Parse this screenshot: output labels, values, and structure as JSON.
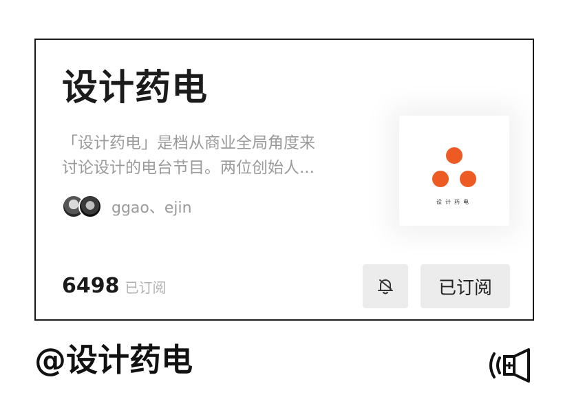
{
  "card": {
    "title": "设计药电",
    "description_line1": "「设计药电」是档从商业全局角度来",
    "description_line2": "讨论设计的电台节目。两位创始人...",
    "hosts": "ggao、ejin",
    "cover_text": "设计药电",
    "subscriber_count": "6498",
    "subscriber_label": "已订阅",
    "subscribe_button": "已订阅",
    "accent_color": "#ee5a24"
  },
  "footer": {
    "channel_name": "@设计药电",
    "sound_icon": "speaker-sound-icon"
  },
  "icons": {
    "bell": "bell-icon",
    "avatars": [
      "host-avatar-1",
      "host-avatar-2"
    ]
  }
}
